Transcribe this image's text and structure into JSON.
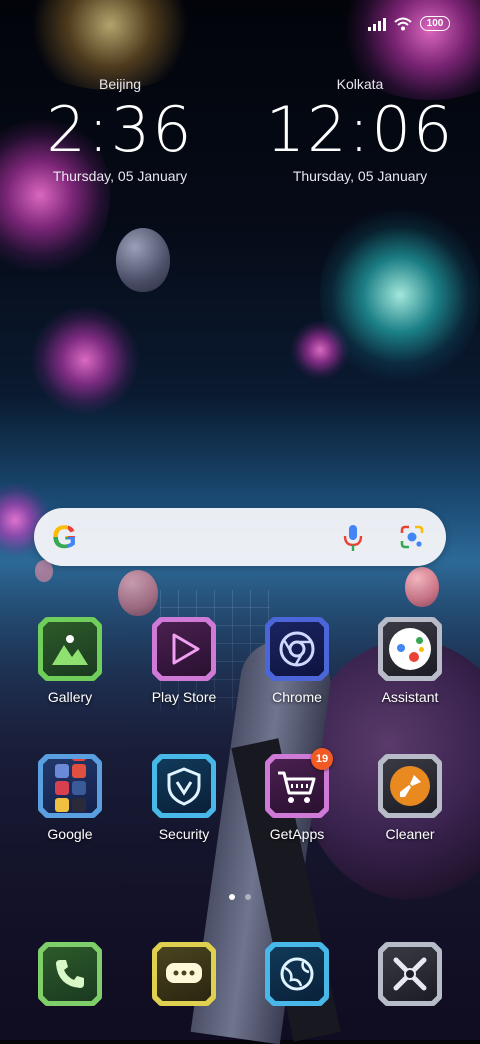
{
  "status_bar": {
    "battery": "100"
  },
  "clocks": [
    {
      "city": "Beijing",
      "time": "2:36",
      "date": "Thursday, 05 January"
    },
    {
      "city": "Kolkata",
      "time": "12:06",
      "date": "Thursday, 05 January"
    }
  ],
  "search": {
    "logo_letter": "G",
    "icons": [
      "google-logo",
      "mic-icon",
      "lens-icon"
    ]
  },
  "apps_row1": [
    {
      "label": "Gallery",
      "icon": "gallery-icon",
      "color": "#6fcf5a"
    },
    {
      "label": "Play Store",
      "icon": "play-store-icon",
      "color": "#d07ad8"
    },
    {
      "label": "Chrome",
      "icon": "chrome-icon",
      "color": "#4a66d8"
    },
    {
      "label": "Assistant",
      "icon": "assistant-icon",
      "color": "#b8bcc8"
    }
  ],
  "apps_row2": [
    {
      "label": "Google",
      "icon": "google-folder-icon",
      "color": "#5aa0e0"
    },
    {
      "label": "Security",
      "icon": "security-shield-icon",
      "color": "#48b8e8"
    },
    {
      "label": "GetApps",
      "icon": "getapps-cart-icon",
      "color": "#d07ad8",
      "badge": "19"
    },
    {
      "label": "Cleaner",
      "icon": "cleaner-brush-icon",
      "color": "#e08a20"
    }
  ],
  "dock": [
    {
      "icon": "phone-icon",
      "color": "#7ecf6a"
    },
    {
      "icon": "messages-icon",
      "color": "#e0d050"
    },
    {
      "icon": "browser-globe-icon",
      "color": "#48b8e8"
    },
    {
      "icon": "camera-icon",
      "color": "#b8bcc8"
    }
  ],
  "page_indicator": {
    "pages": 2,
    "active": 1
  }
}
